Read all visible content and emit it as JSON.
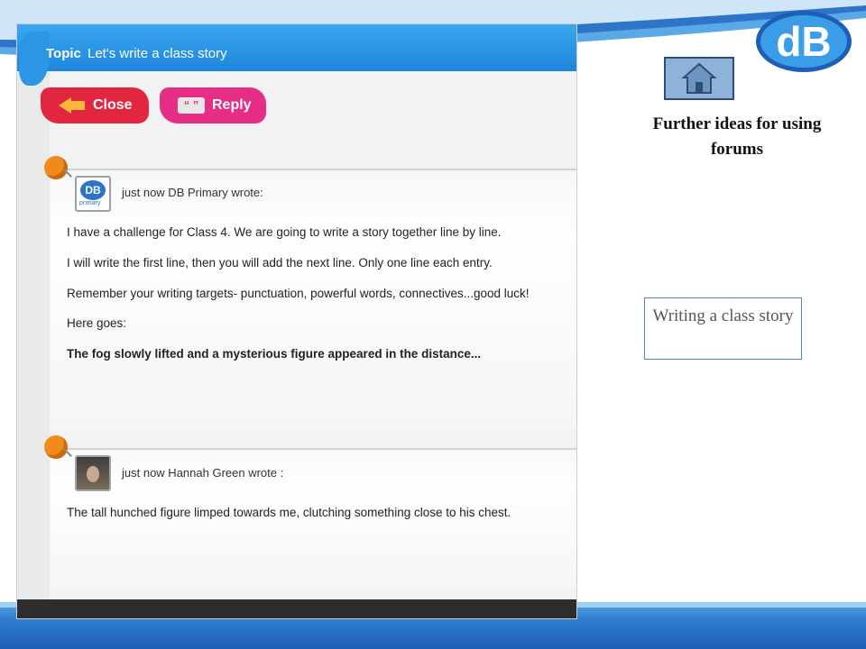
{
  "forum": {
    "topic_label": "Topic",
    "topic_title": "Let's write a class story",
    "close_label": "Close",
    "reply_label": "Reply",
    "reply_icon": "quote-icon",
    "close_icon": "back-arrow-icon",
    "posts": [
      {
        "meta": "just now DB Primary wrote:",
        "avatar_text": "DB",
        "avatar_subtext": "primary",
        "lines": [
          "I have a challenge for Class 4. We are going to write a story together line by line.",
          "I will write the first line, then you will add the next line. Only one line each entry.",
          "Remember your writing targets- punctuation, powerful words, connectives...good luck!",
          "Here goes:",
          "The fog slowly lifted and a mysterious figure appeared in the distance..."
        ]
      },
      {
        "meta": "just now Hannah Green wrote :",
        "lines": [
          "The tall hunched figure limped towards me, clutching something close to his chest."
        ]
      }
    ]
  },
  "sidebar": {
    "logo_text": "dB",
    "home_icon": "home-icon",
    "further_ideas": "Further ideas for using forums",
    "story_link": "Writing a class story"
  },
  "colors": {
    "topic_bar": "#1f86dc",
    "close_button": "#e32640",
    "reply_button": "#e62e86",
    "accent_blue": "#2f7fd0"
  }
}
